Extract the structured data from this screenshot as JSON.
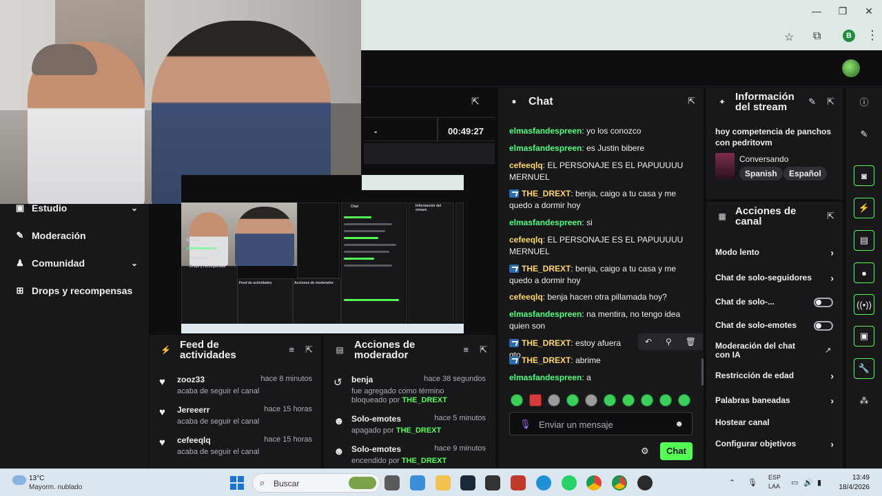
{
  "browser": {
    "minimize": "—",
    "restore": "❐",
    "close": "✕",
    "profile_initial": "B"
  },
  "stats": {
    "dash": "-",
    "uptime": "00:49:27"
  },
  "left_nav": [
    {
      "label": "Estudio",
      "icon": "studio-icon",
      "glyph": "▣",
      "chevron": true
    },
    {
      "label": "Moderación",
      "icon": "wrench-icon",
      "glyph": "🔧",
      "chevron": false
    },
    {
      "label": "Comunidad",
      "icon": "people-icon",
      "glyph": "👥",
      "chevron": true
    },
    {
      "label": "Drops y recompensas",
      "icon": "drops-icon",
      "glyph": "🎁",
      "chevron": false
    }
  ],
  "preview": {
    "chat_label": "Chat",
    "info_label": "Información del stream",
    "feed_label": "Feed de actividades",
    "mod_label": "Acciones de moderador",
    "nav_user": "elmasfandespreen",
    "nav_1": "Estudio",
    "nav_2": "Comunidad",
    "nav_3": "Drops y recompensas"
  },
  "feed": {
    "title": "Feed de actividades",
    "items": [
      {
        "name": "zooz33",
        "time": "hace 8 minutos",
        "desc": "acaba de seguir el canal"
      },
      {
        "name": "Jereeerr",
        "time": "hace 15 horas",
        "desc": "acaba de seguir el canal"
      },
      {
        "name": "cefeeqlq",
        "time": "hace 15 horas",
        "desc": "acaba de seguir el canal"
      }
    ]
  },
  "mod": {
    "title": "Acciones de moderador",
    "items": [
      {
        "name": "benja",
        "time": "hace 38 segundos",
        "desc": "fue agregado como término bloqueado por",
        "by": "THE_DREXT"
      },
      {
        "name": "Solo-emotes",
        "time": "hace 5 minutos",
        "desc": "apagado por",
        "by": "THE_DREXT"
      },
      {
        "name": "Solo-emotes",
        "time": "hace 9 minutos",
        "desc": "encendido por",
        "by": "THE_DREXT"
      }
    ]
  },
  "chat": {
    "title": "Chat",
    "messages": [
      {
        "user": "elmasfandespreen",
        "text": "yo los conozco",
        "color": "green",
        "badge": false
      },
      {
        "user": "elmasfandespreen",
        "text": "es Justin bibere",
        "color": "green",
        "badge": false
      },
      {
        "user": "cefeeqlq",
        "text": "EL PERSONAJE ES EL PAPUUUUU MERNUEL",
        "color": "yellow",
        "badge": false
      },
      {
        "user": "THE_DREXT",
        "text": "benja, caigo a tu casa y me quedo a dormir hoy",
        "color": "yellow",
        "badge": true
      },
      {
        "user": "elmasfandespreen",
        "text": "si",
        "color": "green",
        "badge": false
      },
      {
        "user": "cefeeqlq",
        "text": "EL PERSONAJE ES EL PAPUUUUU MERNUEL",
        "color": "yellow",
        "badge": false
      },
      {
        "user": "THE_DREXT",
        "text": "benja, caigo a tu casa y me quedo a dormir hoy",
        "color": "yellow",
        "badge": true
      },
      {
        "user": "cefeeqlq",
        "text": "benja hacen otra pillamada hoy?",
        "color": "yellow",
        "badge": false
      },
      {
        "user": "elmasfandespreen",
        "text": "na mentira, no tengo idea quien son",
        "color": "green",
        "badge": false
      },
      {
        "user": "THE_DREXT",
        "text": "estoy afuera gto",
        "color": "yellow",
        "badge": true
      },
      {
        "user": "THE_DREXT",
        "text": "abrime",
        "color": "yellow",
        "badge": true
      },
      {
        "user": "elmasfandespreen",
        "text": "a",
        "color": "green",
        "badge": false
      }
    ],
    "input_placeholder": "Enviar un mensaje",
    "send_label": "Chat"
  },
  "info": {
    "title_line1": "Información",
    "title_line2": "del stream",
    "stream_title": "hoy competencia de panchos con pedritovm",
    "category": "Conversando",
    "tags": [
      "Spanish",
      "Español"
    ]
  },
  "actions": {
    "title_line1": "Acciones de",
    "title_line2": "canal",
    "items": [
      {
        "label": "Modo lento",
        "control": "chevron"
      },
      {
        "label": "Chat de solo-seguidores",
        "control": "chevron"
      },
      {
        "label": "Chat de solo-...",
        "control": "toggle"
      },
      {
        "label": "Chat de solo-emotes",
        "control": "toggle"
      },
      {
        "label": "Moderación del chat con IA",
        "control": "external"
      },
      {
        "label": "Restricción de edad",
        "control": "chevron"
      },
      {
        "label": "Palabras baneadas",
        "control": "chevron"
      },
      {
        "label": "Hostear canal",
        "control": "none"
      },
      {
        "label": "Configurar objetivos",
        "control": "chevron"
      }
    ]
  },
  "taskbar": {
    "temp": "13°C",
    "weather": "Mayorm. nublado",
    "search": "Buscar",
    "lang1": "ESP",
    "lang2": "LAA",
    "time": "13:49",
    "date": "18/4/2026"
  },
  "colors": {
    "accent_green": "#54ff54",
    "panel": "#18181b",
    "bg": "#0e0e10",
    "user_green": "#4dff7f",
    "user_yellow": "#ffd966"
  }
}
